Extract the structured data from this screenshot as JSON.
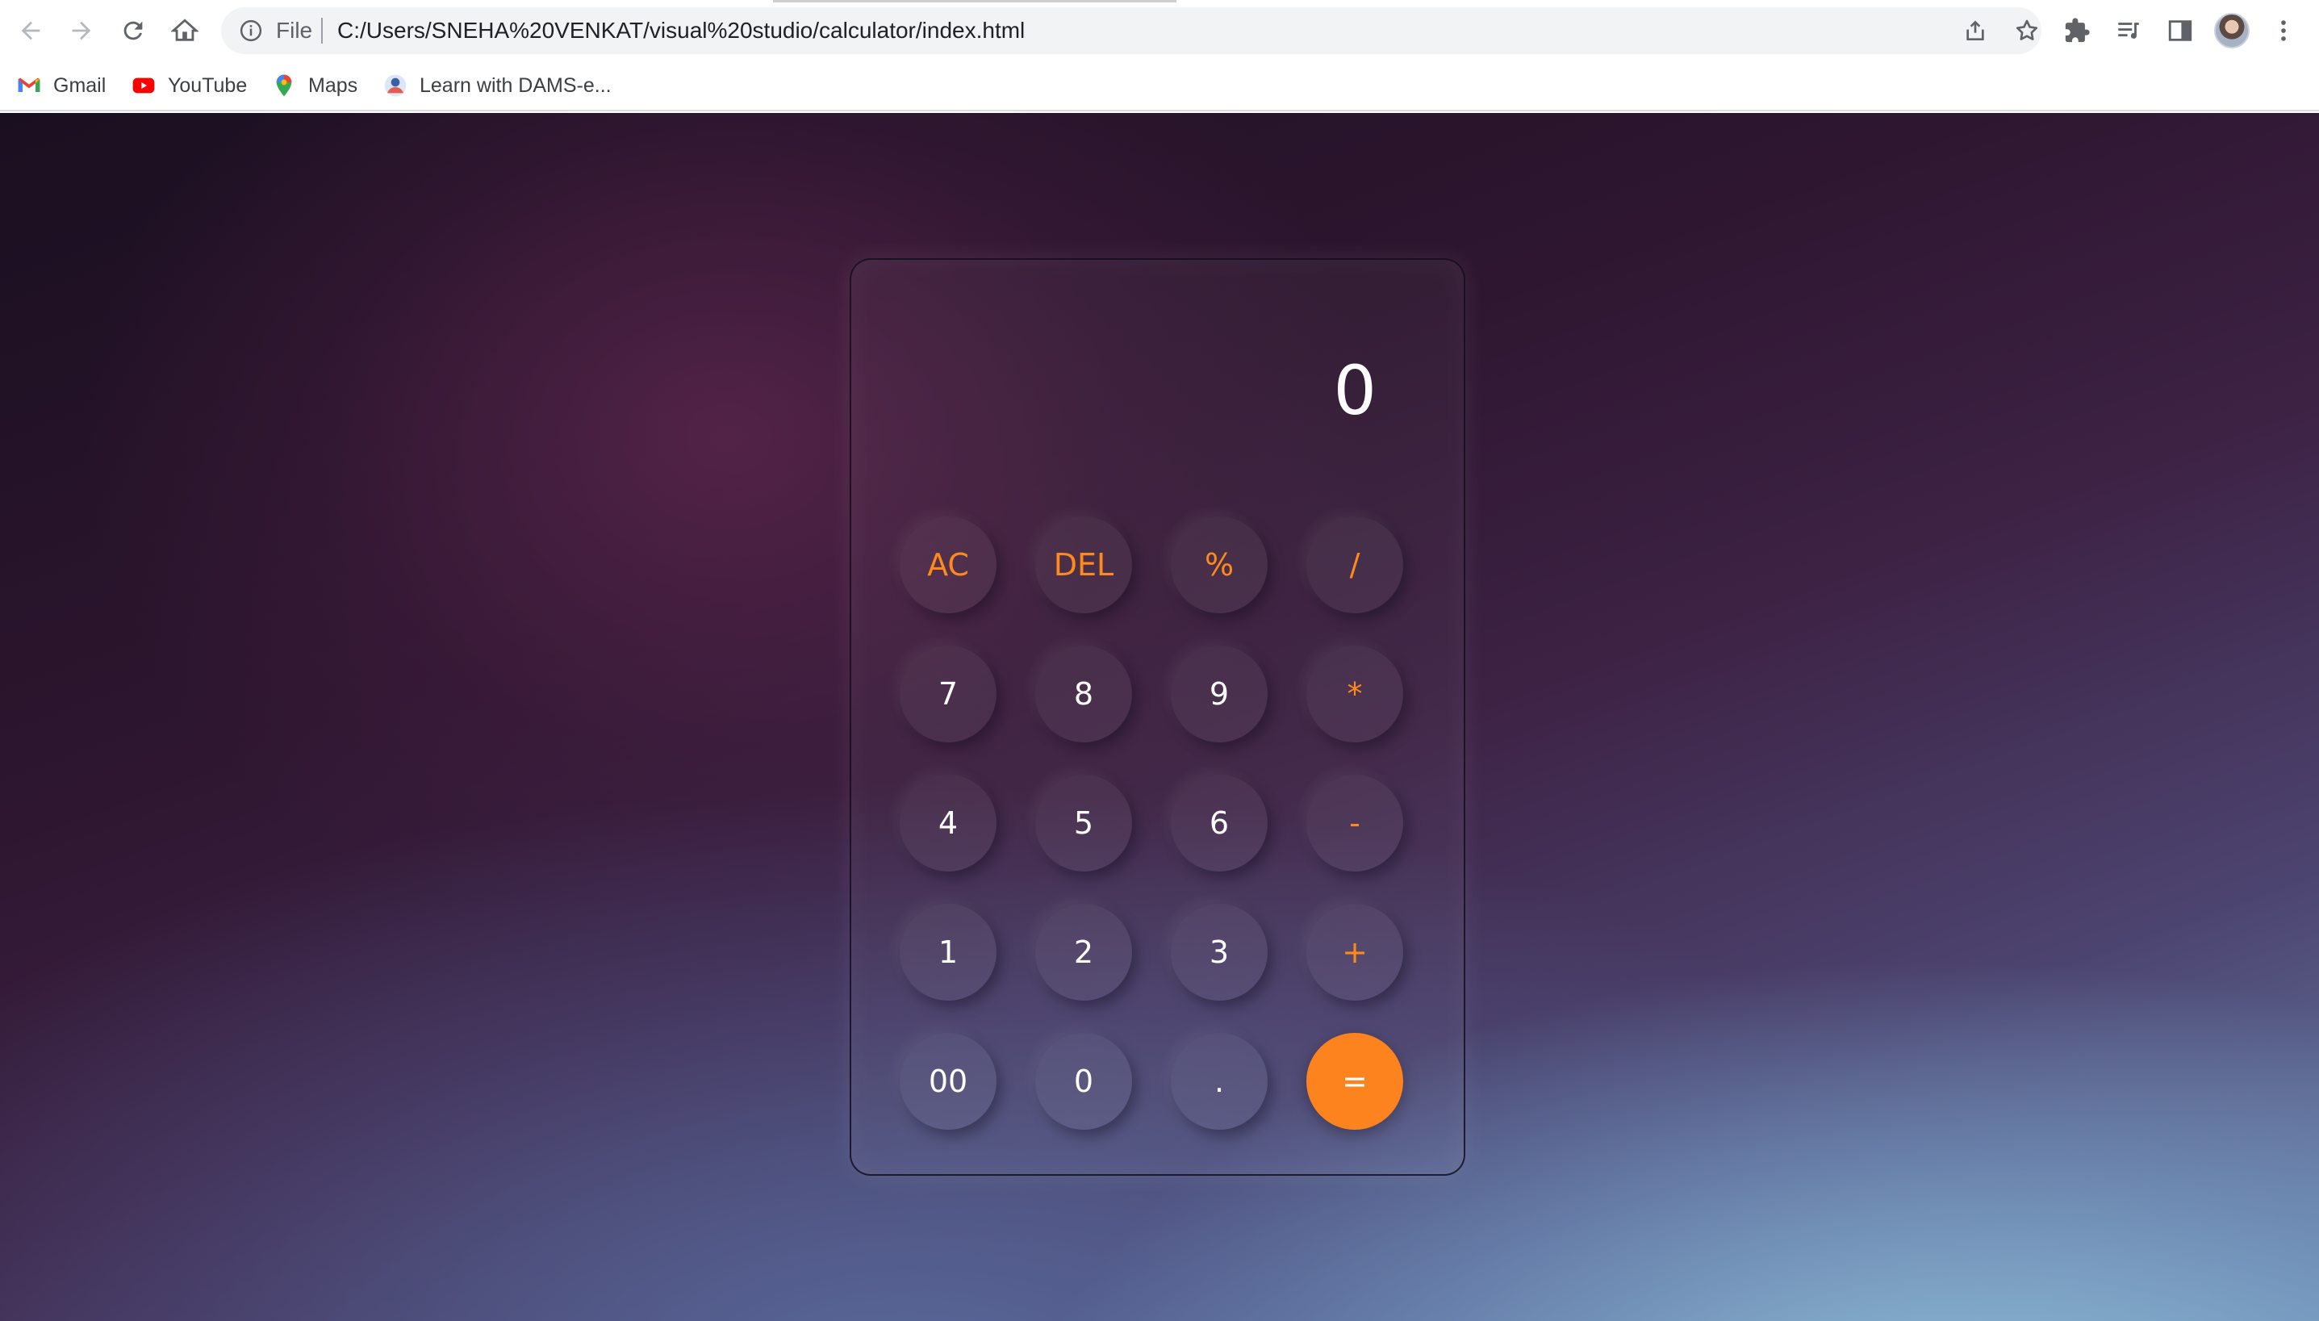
{
  "browser": {
    "scheme_label": "File",
    "url": "C:/Users/SNEHA%20VENKAT/visual%20studio/calculator/index.html",
    "bookmarks": [
      {
        "label": "Gmail",
        "icon": "gmail-icon"
      },
      {
        "label": "YouTube",
        "icon": "youtube-icon"
      },
      {
        "label": "Maps",
        "icon": "maps-icon"
      },
      {
        "label": "Learn with DAMS-e...",
        "icon": "dams-icon"
      }
    ],
    "toolbar_icons": [
      "back-arrow-icon",
      "forward-arrow-icon",
      "reload-icon",
      "home-icon",
      "info-icon",
      "share-icon",
      "star-icon",
      "extensions-icon",
      "media-icon",
      "side-panel-icon",
      "profile-avatar",
      "menu-icon"
    ]
  },
  "calculator": {
    "display": "0",
    "keys": {
      "r1": [
        "AC",
        "DEL",
        "%",
        "/"
      ],
      "r2": [
        "7",
        "8",
        "9",
        "*"
      ],
      "r3": [
        "4",
        "5",
        "6",
        "-"
      ],
      "r4": [
        "1",
        "2",
        "3",
        "+"
      ],
      "r5": [
        "00",
        "0",
        ".",
        "="
      ]
    },
    "colors": {
      "operator": "#ff8a1a",
      "equals_bg": "#fd831e",
      "digit": "#ffffff"
    }
  }
}
